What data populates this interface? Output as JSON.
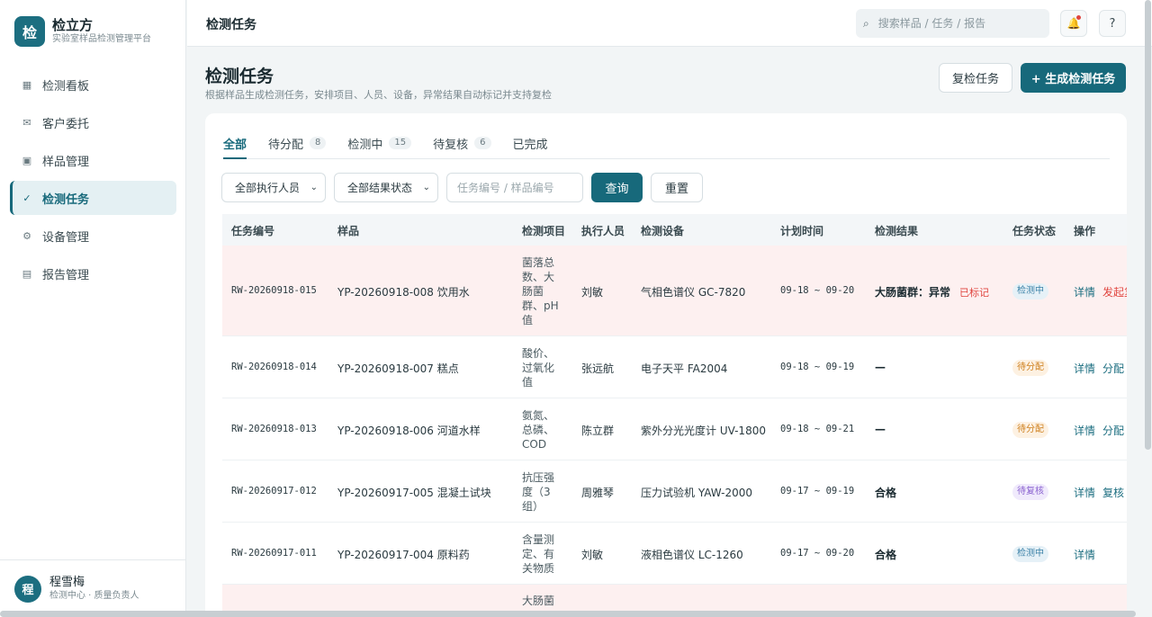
{
  "brand": {
    "logo_char": "检",
    "name": "检立方",
    "subtitle": "实验室样品检测管理平台"
  },
  "nav": [
    {
      "icon": "▦",
      "label": "检测看板",
      "icon_name": "grid-icon"
    },
    {
      "icon": "✉",
      "label": "客户委托",
      "icon_name": "mail-icon"
    },
    {
      "icon": "▣",
      "label": "样品管理",
      "icon_name": "sample-icon"
    },
    {
      "icon": "✓",
      "label": "检测任务",
      "icon_name": "check-icon",
      "active": true
    },
    {
      "icon": "⚙",
      "label": "设备管理",
      "icon_name": "gear-icon"
    },
    {
      "icon": "▤",
      "label": "报告管理",
      "icon_name": "report-icon"
    }
  ],
  "user": {
    "avatar_char": "程",
    "name": "程雪梅",
    "role": "检测中心 · 质量负责人"
  },
  "topbar": {
    "title": "检测任务",
    "search_placeholder": "搜索样品 / 任务 / 报告",
    "search_icon": "⌕",
    "bell_icon": "🔔",
    "help_icon": "?"
  },
  "page": {
    "title": "检测任务",
    "subtitle": "根据样品生成检测任务，安排项目、人员、设备，异常结果自动标记并支持复检",
    "recheck_label": "复检任务",
    "create_label": "+ 生成检测任务"
  },
  "tabs": [
    {
      "label": "全部",
      "count": null,
      "active": true
    },
    {
      "label": "待分配",
      "count": "8"
    },
    {
      "label": "检测中",
      "count": "15"
    },
    {
      "label": "待复核",
      "count": "6"
    },
    {
      "label": "已完成",
      "count": null
    }
  ],
  "filters": {
    "executor": "全部执行人员",
    "result_status": "全部结果状态",
    "keyword_placeholder": "任务编号 / 样品编号",
    "query_label": "查询",
    "reset_label": "重置"
  },
  "table": {
    "headers": [
      "任务编号",
      "样品",
      "检测项目",
      "执行人员",
      "检测设备",
      "计划时间",
      "检测结果",
      "任务状态",
      "操作"
    ],
    "rows": [
      {
        "id": "RW-20260918-015",
        "sample": "YP-20260918-008 饮用水",
        "items": [
          "菌落总",
          "数、大",
          "肠菌",
          "群、pH",
          "值"
        ],
        "executor": "刘敏",
        "device": "气相色谱仪 GC-7820",
        "time": "09-18 ~ 09-20",
        "result": "大肠菌群：异常",
        "flag": "已标记",
        "status": "检测中",
        "status_key": "testing",
        "actions": [
          "详情",
          "发起复检"
        ],
        "abnormal": true
      },
      {
        "id": "RW-20260918-014",
        "sample": "YP-20260918-007 糕点",
        "items": [
          "酸价、",
          "过氧化",
          "值"
        ],
        "executor": "张远航",
        "device": "电子天平 FA2004",
        "time": "09-18 ~ 09-19",
        "result": "—",
        "flag": "",
        "status": "待分配",
        "status_key": "pending",
        "actions": [
          "详情",
          "分配"
        ]
      },
      {
        "id": "RW-20260918-013",
        "sample": "YP-20260918-006 河道水样",
        "items": [
          "氨氮、",
          "总磷、",
          "COD"
        ],
        "executor": "陈立群",
        "device": "紫外分光光度计 UV-1800",
        "time": "09-18 ~ 09-21",
        "result": "—",
        "flag": "",
        "status": "待分配",
        "status_key": "pending",
        "actions": [
          "详情",
          "分配"
        ]
      },
      {
        "id": "RW-20260917-012",
        "sample": "YP-20260917-005 混凝土试块",
        "items": [
          "抗压强",
          "度（3",
          "组）"
        ],
        "executor": "周雅琴",
        "device": "压力试验机 YAW-2000",
        "time": "09-17 ~ 09-19",
        "result": "合格",
        "flag": "",
        "status": "待复核",
        "status_key": "review",
        "actions": [
          "详情",
          "复核"
        ]
      },
      {
        "id": "RW-20260917-011",
        "sample": "YP-20260917-004 原料药",
        "items": [
          "含量测",
          "定、有",
          "关物质"
        ],
        "executor": "刘敏",
        "device": "液相色谱仪 LC-1260",
        "time": "09-17 ~ 09-20",
        "result": "合格",
        "flag": "",
        "status": "检测中",
        "status_key": "testing",
        "actions": [
          "详情"
        ]
      },
      {
        "id": "",
        "sample": "",
        "items": [
          "大肠菌"
        ],
        "executor": "",
        "device": "",
        "time": "",
        "result": "",
        "flag": "",
        "status": "",
        "status_key": "",
        "actions": [],
        "abnormal": true
      }
    ]
  }
}
